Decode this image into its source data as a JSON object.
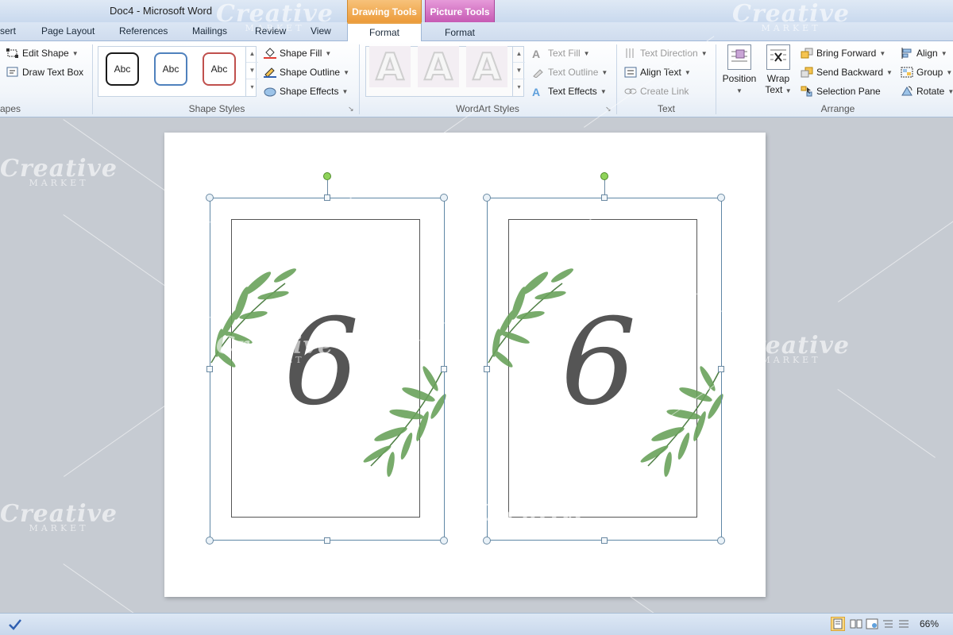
{
  "window": {
    "title": "Doc4  -  Microsoft Word",
    "context_tabs": {
      "drawing_tools": "Drawing Tools",
      "picture_tools": "Picture Tools"
    }
  },
  "tabs": {
    "insert": "sert",
    "page_layout": "Page Layout",
    "references": "References",
    "mailings": "Mailings",
    "review": "Review",
    "view": "View",
    "format_drawing": "Format",
    "format_picture": "Format"
  },
  "ribbon": {
    "insert_shapes": {
      "edit_shape": "Edit Shape",
      "draw_text_box": "Draw Text Box",
      "label": "apes"
    },
    "shape_styles": {
      "label": "Shape Styles",
      "styles": [
        {
          "text": "Abc",
          "color": "#1a1a1a"
        },
        {
          "text": "Abc",
          "color": "#4f81bd"
        },
        {
          "text": "Abc",
          "color": "#c0504d"
        }
      ],
      "shape_fill": "Shape Fill",
      "shape_outline": "Shape Outline",
      "shape_effects": "Shape Effects"
    },
    "wordart_styles": {
      "label": "WordArt Styles",
      "letters": [
        "A",
        "A",
        "A"
      ],
      "text_fill": "Text Fill",
      "text_outline": "Text Outline",
      "text_effects": "Text Effects"
    },
    "text": {
      "label": "Text",
      "text_direction": "Text Direction",
      "align_text": "Align Text",
      "create_link": "Create Link"
    },
    "arrange": {
      "label": "Arrange",
      "position": "Position",
      "wrap_text_1": "Wrap",
      "wrap_text_2": "Text",
      "bring_forward": "Bring Forward",
      "send_backward": "Send Backward",
      "selection_pane": "Selection Pane",
      "align": "Align",
      "group": "Group",
      "rotate": "Rotate"
    }
  },
  "document": {
    "cards": [
      {
        "number": "6"
      },
      {
        "number": "6"
      }
    ]
  },
  "watermark": {
    "brand": "Creative",
    "sub": "MARKET"
  },
  "statusbar": {
    "zoom": "66%"
  },
  "colors": {
    "accent_drawing": "#ec9b3a",
    "accent_picture": "#c65ab4",
    "leaf_green": "#5e9a52"
  }
}
